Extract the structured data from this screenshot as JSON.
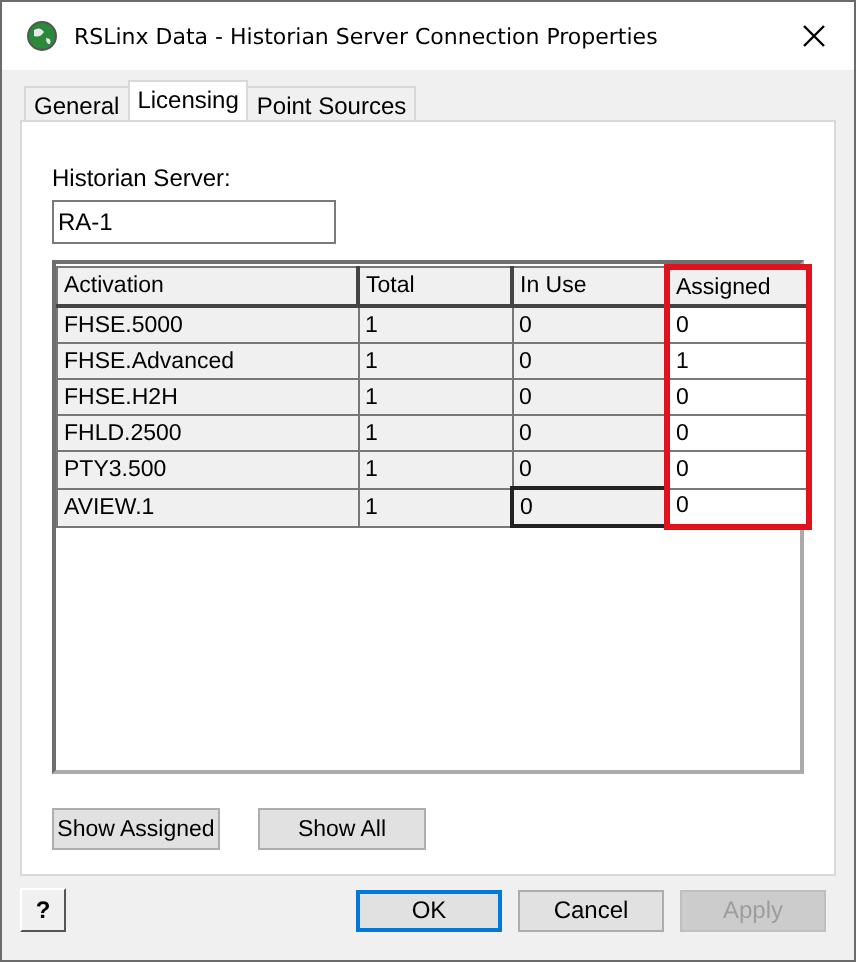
{
  "window": {
    "title": "RSLinx Data - Historian Server Connection Properties"
  },
  "tabs": [
    {
      "label": "General",
      "selected": false
    },
    {
      "label": "Licensing",
      "selected": true
    },
    {
      "label": "Point Sources",
      "selected": false
    }
  ],
  "server_field": {
    "label": "Historian Server:",
    "value": "RA-1"
  },
  "table": {
    "columns": [
      {
        "label": "Activation",
        "editable": false,
        "highlighted": false
      },
      {
        "label": "Total",
        "editable": false,
        "highlighted": false
      },
      {
        "label": "In Use",
        "editable": false,
        "highlighted": false
      },
      {
        "label": "Assigned",
        "editable": true,
        "highlighted": true
      }
    ],
    "rows": [
      [
        {
          "text": "FHSE.5000",
          "focused": false
        },
        {
          "text": "1",
          "focused": false
        },
        {
          "text": "0",
          "focused": false
        },
        {
          "text": "0",
          "focused": false
        }
      ],
      [
        {
          "text": "FHSE.Advanced",
          "focused": false
        },
        {
          "text": "1",
          "focused": false
        },
        {
          "text": "0",
          "focused": false
        },
        {
          "text": "1",
          "focused": false
        }
      ],
      [
        {
          "text": "FHSE.H2H",
          "focused": false
        },
        {
          "text": "1",
          "focused": false
        },
        {
          "text": "0",
          "focused": false
        },
        {
          "text": "0",
          "focused": false
        }
      ],
      [
        {
          "text": "FHLD.2500",
          "focused": false
        },
        {
          "text": "1",
          "focused": false
        },
        {
          "text": "0",
          "focused": false
        },
        {
          "text": "0",
          "focused": false
        }
      ],
      [
        {
          "text": "PTY3.500",
          "focused": false
        },
        {
          "text": "1",
          "focused": false
        },
        {
          "text": "0",
          "focused": false
        },
        {
          "text": "0",
          "focused": false
        }
      ],
      [
        {
          "text": "AVIEW.1",
          "focused": false
        },
        {
          "text": "1",
          "focused": false
        },
        {
          "text": "0",
          "focused": true
        },
        {
          "text": "0",
          "focused": false
        }
      ]
    ]
  },
  "panel_buttons": [
    {
      "label": "Show Assigned"
    },
    {
      "label": "Show All"
    }
  ],
  "dialog_buttons": [
    {
      "label": "OK",
      "default": true,
      "disabled": false
    },
    {
      "label": "Cancel",
      "default": false,
      "disabled": false
    },
    {
      "label": "Apply",
      "default": false,
      "disabled": true
    }
  ],
  "help_button": {
    "glyph": "?"
  }
}
